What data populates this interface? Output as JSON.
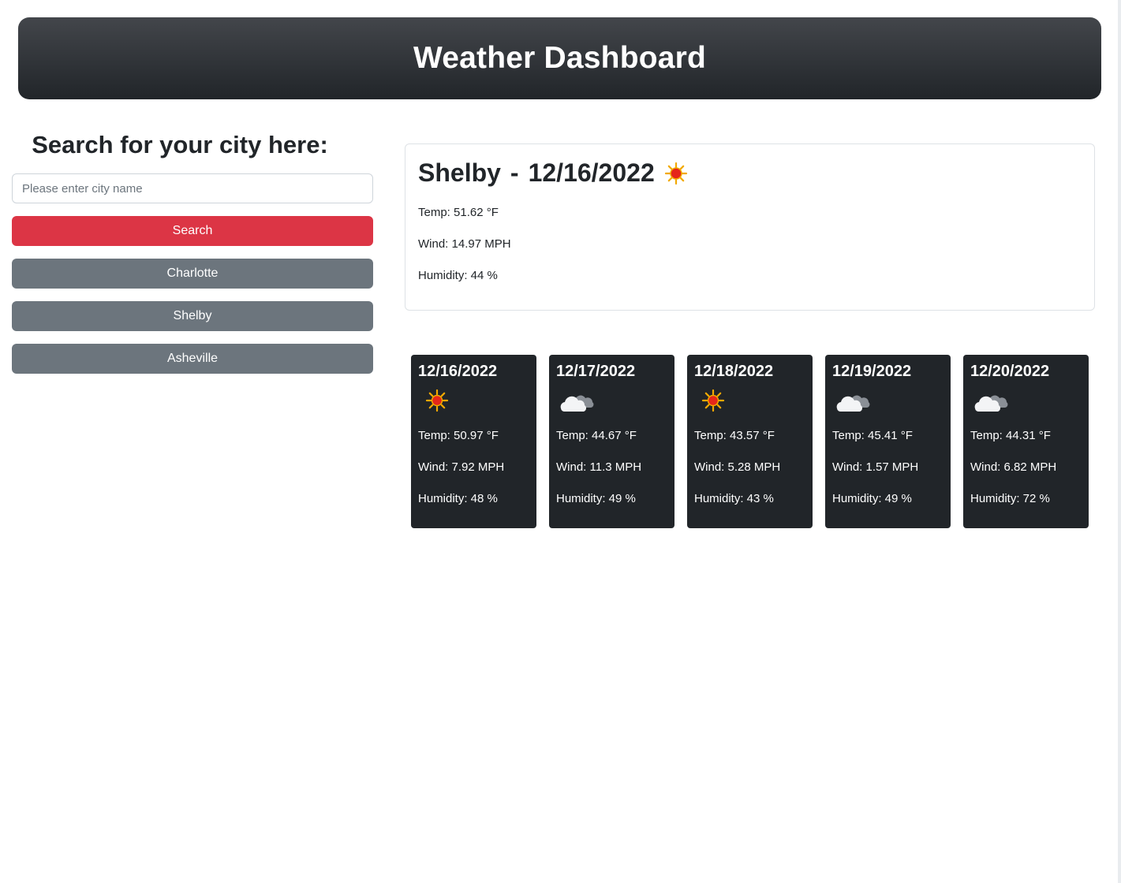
{
  "header": {
    "title": "Weather Dashboard"
  },
  "search": {
    "heading": "Search for your city here:",
    "placeholder": "Please enter city name",
    "value": "",
    "button_label": "Search",
    "history": [
      "Charlotte",
      "Shelby",
      "Asheville"
    ]
  },
  "current": {
    "city": "Shelby",
    "separator": "-",
    "date": "12/16/2022",
    "icon": "sun-icon",
    "temp": "Temp: 51.62 °F",
    "wind": "Wind: 14.97 MPH",
    "humidity": "Humidity: 44 %"
  },
  "forecast": [
    {
      "date": "12/16/2022",
      "icon": "sun-icon",
      "temp": "Temp: 50.97 °F",
      "wind": "Wind: 7.92 MPH",
      "humidity": "Humidity: 48 %"
    },
    {
      "date": "12/17/2022",
      "icon": "cloud-icon",
      "temp": "Temp: 44.67 °F",
      "wind": "Wind: 11.3 MPH",
      "humidity": "Humidity: 49 %"
    },
    {
      "date": "12/18/2022",
      "icon": "sun-icon",
      "temp": "Temp: 43.57 °F",
      "wind": "Wind: 5.28 MPH",
      "humidity": "Humidity: 43 %"
    },
    {
      "date": "12/19/2022",
      "icon": "cloud-icon",
      "temp": "Temp: 45.41 °F",
      "wind": "Wind: 1.57 MPH",
      "humidity": "Humidity: 49 %"
    },
    {
      "date": "12/20/2022",
      "icon": "cloud-icon",
      "temp": "Temp: 44.31 °F",
      "wind": "Wind: 6.82 MPH",
      "humidity": "Humidity: 72 %"
    }
  ],
  "colors": {
    "header_gradient_top": "#43464b",
    "header_gradient_bottom": "#212529",
    "search_button": "#dc3545",
    "history_button": "#6c757d",
    "forecast_card": "#212529"
  }
}
